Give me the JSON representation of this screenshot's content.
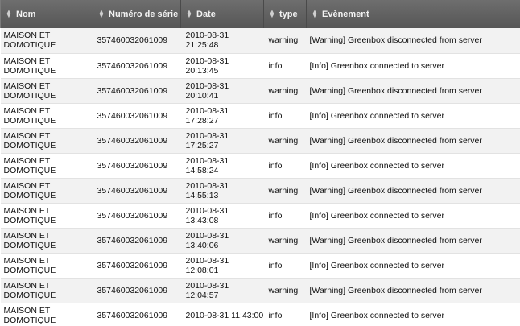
{
  "columns": {
    "nom": "Nom",
    "serie": "Numéro de série",
    "date": "Date",
    "type": "type",
    "event": "Evènement"
  },
  "icons": {
    "sort": "sort-arrows-icon"
  },
  "rows": [
    {
      "nom": "MAISON ET DOMOTIQUE",
      "serie": "357460032061009",
      "date": "2010-08-31 21:25:48",
      "type": "warning",
      "event": "[Warning] Greenbox disconnected from server"
    },
    {
      "nom": "MAISON ET DOMOTIQUE",
      "serie": "357460032061009",
      "date": "2010-08-31 20:13:45",
      "type": "info",
      "event": "[Info] Greenbox connected to server"
    },
    {
      "nom": "MAISON ET DOMOTIQUE",
      "serie": "357460032061009",
      "date": "2010-08-31 20:10:41",
      "type": "warning",
      "event": "[Warning] Greenbox disconnected from server"
    },
    {
      "nom": "MAISON ET DOMOTIQUE",
      "serie": "357460032061009",
      "date": "2010-08-31 17:28:27",
      "type": "info",
      "event": "[Info] Greenbox connected to server"
    },
    {
      "nom": "MAISON ET DOMOTIQUE",
      "serie": "357460032061009",
      "date": "2010-08-31 17:25:27",
      "type": "warning",
      "event": "[Warning] Greenbox disconnected from server"
    },
    {
      "nom": "MAISON ET DOMOTIQUE",
      "serie": "357460032061009",
      "date": "2010-08-31 14:58:24",
      "type": "info",
      "event": "[Info] Greenbox connected to server"
    },
    {
      "nom": "MAISON ET DOMOTIQUE",
      "serie": "357460032061009",
      "date": "2010-08-31 14:55:13",
      "type": "warning",
      "event": "[Warning] Greenbox disconnected from server"
    },
    {
      "nom": "MAISON ET DOMOTIQUE",
      "serie": "357460032061009",
      "date": "2010-08-31 13:43:08",
      "type": "info",
      "event": "[Info] Greenbox connected to server"
    },
    {
      "nom": "MAISON ET DOMOTIQUE",
      "serie": "357460032061009",
      "date": "2010-08-31 13:40:06",
      "type": "warning",
      "event": "[Warning] Greenbox disconnected from server"
    },
    {
      "nom": "MAISON ET DOMOTIQUE",
      "serie": "357460032061009",
      "date": "2010-08-31 12:08:01",
      "type": "info",
      "event": "[Info] Greenbox connected to server"
    },
    {
      "nom": "MAISON ET DOMOTIQUE",
      "serie": "357460032061009",
      "date": "2010-08-31 12:04:57",
      "type": "warning",
      "event": "[Warning] Greenbox disconnected from server"
    },
    {
      "nom": "MAISON ET DOMOTIQUE",
      "serie": "357460032061009",
      "date": "2010-08-31 11:43:00",
      "type": "info",
      "event": "[Info] Greenbox connected to server"
    }
  ]
}
